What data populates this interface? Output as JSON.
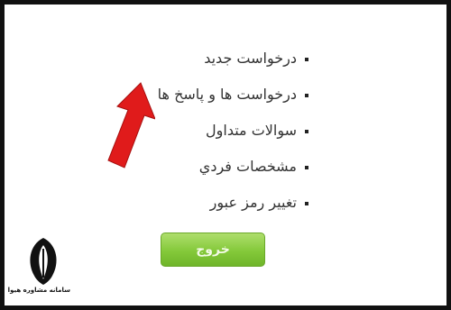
{
  "menu": {
    "items": [
      {
        "label": "درخواست جديد"
      },
      {
        "label": "درخواست ها و پاسخ ها"
      },
      {
        "label": "سوالات متداول"
      },
      {
        "label": "مشخصات فردي"
      },
      {
        "label": "تغيير رمز عبور"
      }
    ]
  },
  "exit_button": {
    "label": "خروج"
  },
  "watermark": {
    "text": "سامانه مشاوره هیوا"
  },
  "colors": {
    "frame": "#111111",
    "button_green": "#84c93a",
    "arrow_red": "#e01b1b"
  },
  "icons": {
    "arrow": "red-arrow-icon",
    "logo": "quill-logo-icon"
  }
}
